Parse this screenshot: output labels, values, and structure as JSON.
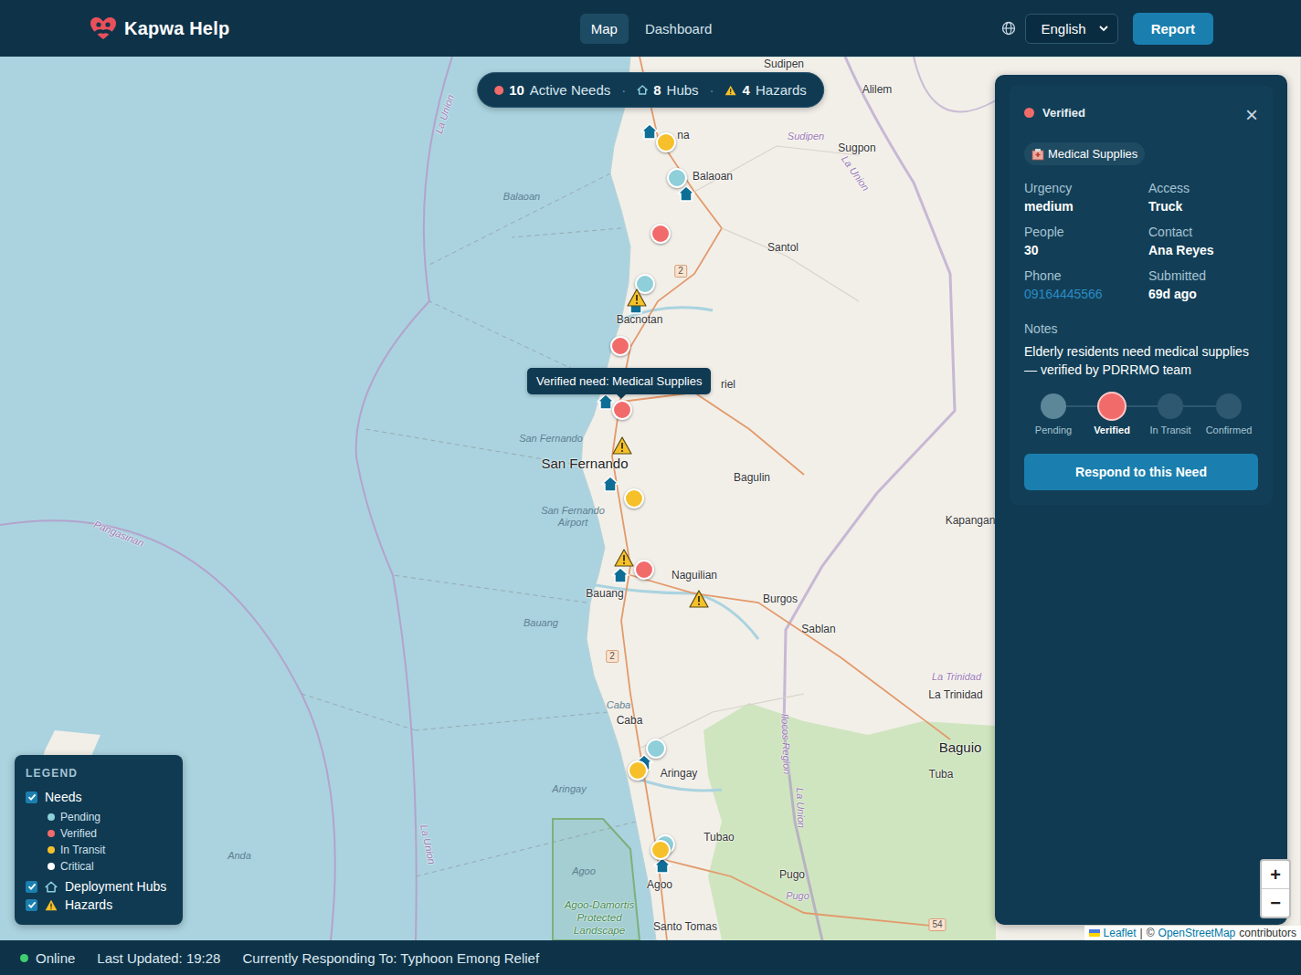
{
  "app": {
    "name": "Kapwa Help"
  },
  "nav": [
    {
      "label": "Map",
      "selected": true
    },
    {
      "label": "Dashboard",
      "selected": false
    }
  ],
  "language": {
    "value": "English"
  },
  "report_button": "Report",
  "summary": {
    "separator": "·",
    "items": [
      {
        "kind": "needs",
        "count": "10",
        "label": "Active Needs"
      },
      {
        "kind": "hubs",
        "count": "8",
        "label": "Hubs"
      },
      {
        "kind": "hazards",
        "count": "4",
        "label": "Hazards"
      }
    ]
  },
  "map": {
    "labels": [
      {
        "text": "Sudipen",
        "kind": "town"
      },
      {
        "text": "Alilem",
        "kind": "town"
      },
      {
        "text": "Sudipen",
        "kind": "region"
      },
      {
        "text": "Sugpon",
        "kind": "town"
      },
      {
        "text": "La Union",
        "kind": "region"
      },
      {
        "text": "Balaoan",
        "kind": "town"
      },
      {
        "text": "Balaoan",
        "kind": "water"
      },
      {
        "text": "La Union",
        "kind": "region"
      },
      {
        "text": "Santol",
        "kind": "town"
      },
      {
        "text": "Bacnotan",
        "kind": "town"
      },
      {
        "text": "riel",
        "kind": "town"
      },
      {
        "text": "San Fernando",
        "kind": "water"
      },
      {
        "text": "San Fernando",
        "kind": "city"
      },
      {
        "text": "San Fernando Airport",
        "kind": "water"
      },
      {
        "text": "Bagulin",
        "kind": "town"
      },
      {
        "text": "Naguilian",
        "kind": "town"
      },
      {
        "text": "Burgos",
        "kind": "town"
      },
      {
        "text": "Sablan",
        "kind": "town"
      },
      {
        "text": "Bauang",
        "kind": "town"
      },
      {
        "text": "Kapangan",
        "kind": "town"
      },
      {
        "text": "Bauang",
        "kind": "water"
      },
      {
        "text": "Caba",
        "kind": "water"
      },
      {
        "text": "Caba",
        "kind": "town"
      },
      {
        "text": "Aringay",
        "kind": "town"
      },
      {
        "text": "Aringay",
        "kind": "water"
      },
      {
        "text": "La Trinidad",
        "kind": "region"
      },
      {
        "text": "La Trinidad",
        "kind": "town"
      },
      {
        "text": "Baguio",
        "kind": "city"
      },
      {
        "text": "Tuba",
        "kind": "town"
      },
      {
        "text": "Ilocos Region",
        "kind": "region"
      },
      {
        "text": "La Union",
        "kind": "region"
      },
      {
        "text": "Tubao",
        "kind": "town"
      },
      {
        "text": "Agoo",
        "kind": "water"
      },
      {
        "text": "Agoo",
        "kind": "town"
      },
      {
        "text": "Pugo",
        "kind": "town"
      },
      {
        "text": "Pugo",
        "kind": "region"
      },
      {
        "text": "Agoo-Damortis Protected Landscape",
        "kind": "protected"
      },
      {
        "text": "Santo Tomas",
        "kind": "town"
      },
      {
        "text": "Pangasinan",
        "kind": "region"
      },
      {
        "text": "La Union",
        "kind": "region"
      },
      {
        "text": "Anda",
        "kind": "water"
      },
      {
        "text": "2",
        "kind": "shield"
      },
      {
        "text": "2",
        "kind": "shield"
      },
      {
        "text": "54",
        "kind": "shield"
      },
      {
        "text": "na",
        "kind": "town"
      }
    ],
    "needs": [
      {
        "status": "in-transit",
        "color": "#f5c02a"
      },
      {
        "status": "pending",
        "color": "#8ecfd9"
      },
      {
        "status": "verified",
        "color": "#f26b6b"
      },
      {
        "status": "pending",
        "color": "#8ecfd9"
      },
      {
        "status": "verified",
        "color": "#f26b6b"
      },
      {
        "status": "verified",
        "color": "#f26b6b"
      },
      {
        "status": "in-transit",
        "color": "#f5c02a"
      },
      {
        "status": "verified",
        "color": "#f26b6b"
      },
      {
        "status": "pending",
        "color": "#8ecfd9"
      },
      {
        "status": "in-transit",
        "color": "#f5c02a"
      },
      {
        "status": "pending",
        "color": "#8ecfd9"
      },
      {
        "status": "in-transit",
        "color": "#f5c02a"
      }
    ],
    "tooltip": "Verified need: Medical Supplies",
    "zoom": [
      "+",
      "−"
    ],
    "attribution": {
      "library": "Leaflet",
      "separator": "|",
      "copyright": "©",
      "source": "OpenStreetMap",
      "suffix": "contributors"
    }
  },
  "legend": {
    "title": "LEGEND",
    "layers": [
      {
        "label": "Needs",
        "checked": true,
        "kind": "needs"
      },
      {
        "label": "Deployment Hubs",
        "checked": true,
        "kind": "hubs"
      },
      {
        "label": "Hazards",
        "checked": true,
        "kind": "hazards"
      }
    ],
    "statuses": [
      {
        "label": "Pending",
        "color": "#8ecfd9"
      },
      {
        "label": "Verified",
        "color": "#f26b6b"
      },
      {
        "label": "In Transit",
        "color": "#f5c02a"
      },
      {
        "label": "Critical",
        "color": "#ffffff"
      }
    ]
  },
  "detail": {
    "status": "Verified",
    "status_color": "#f26b6b",
    "close": "×",
    "category": "Medical Supplies",
    "fields": [
      {
        "label": "Urgency",
        "value": "medium",
        "kind": "text"
      },
      {
        "label": "Access",
        "value": "Truck",
        "kind": "text"
      },
      {
        "label": "People",
        "value": "30",
        "kind": "text"
      },
      {
        "label": "Contact",
        "value": "Ana Reyes",
        "kind": "text"
      },
      {
        "label": "Phone",
        "value": "09164445566",
        "kind": "link"
      },
      {
        "label": "Submitted",
        "value": "69d ago",
        "kind": "text"
      }
    ],
    "notes_label": "Notes",
    "notes": "Elderly residents need medical supplies — verified by PDRRMO team",
    "steps": [
      {
        "label": "Pending",
        "selected": false,
        "done": true
      },
      {
        "label": "Verified",
        "selected": true,
        "done": true
      },
      {
        "label": "In Transit",
        "selected": false,
        "done": false
      },
      {
        "label": "Confirmed",
        "selected": false,
        "done": false
      }
    ],
    "action": "Respond to this Need"
  },
  "status_bar": {
    "connection": "Online",
    "online": true,
    "last_updated": "Last Updated: 19:28",
    "responding": "Currently Responding To: Typhoon Emong Relief"
  }
}
